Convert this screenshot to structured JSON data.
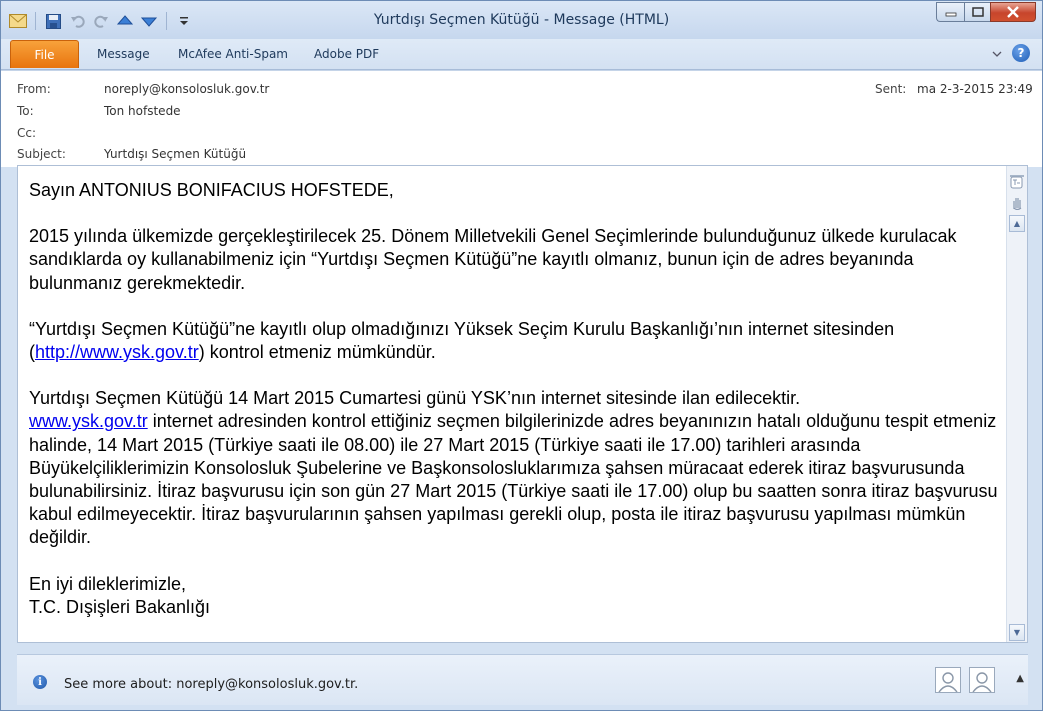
{
  "window": {
    "title": "Yurtdışı Seçmen Kütüğü  -  Message (HTML)"
  },
  "ribbon": {
    "tabs": [
      "File",
      "Message",
      "McAfee Anti-Spam",
      "Adobe PDF"
    ]
  },
  "header": {
    "from_label": "From:",
    "from_value": "noreply@konsolosluk.gov.tr",
    "to_label": "To:",
    "to_value": "Ton hofstede",
    "cc_label": "Cc:",
    "cc_value": "",
    "subject_label": "Subject:",
    "subject_value": "Yurtdışı Seçmen Kütüğü",
    "sent_label": "Sent:",
    "sent_value": "ma 2-3-2015 23:49"
  },
  "body": {
    "greeting": "Sayın ANTONIUS BONIFACIUS HOFSTEDE,",
    "p1": "2015 yılında ülkemizde gerçekleştirilecek 25. Dönem Milletvekili Genel Seçimlerinde bulunduğunuz ülkede kurulacak sandıklarda oy kullanabilmeniz için “Yurtdışı Seçmen Kütüğü”ne kayıtlı olmanız, bunun için de adres beyanında bulunmanız gerekmektedir.",
    "p2_before": "“Yurtdışı Seçmen Kütüğü”ne kayıtlı olup olmadığınızı Yüksek Seçim Kurulu Başkanlığı’nın internet sitesinden (",
    "p2_link": "http://www.ysk.gov.tr",
    "p2_after": ") kontrol etmeniz mümkündür.",
    "p3_line1": "Yurtdışı Seçmen Kütüğü 14 Mart 2015 Cumartesi günü YSK’nın internet sitesinde ilan edilecektir.",
    "p3_link": "www.ysk.gov.tr",
    "p3_rest": " internet adresinden kontrol ettiğiniz seçmen bilgilerinizde adres beyanınızın hatalı olduğunu tespit etmeniz halinde, 14 Mart 2015 (Türkiye saati ile 08.00) ile 27 Mart 2015 (Türkiye saati ile 17.00) tarihleri arasında Büyükelçiliklerimizin Konsolosluk Şubelerine ve Başkonsolosluklarımıza şahsen müracaat ederek itiraz başvurusunda bulunabilirsiniz. İtiraz başvurusu için son gün 27 Mart 2015 (Türkiye saati ile 17.00) olup bu saatten sonra itiraz başvurusu kabul edilmeyecektir. İtiraz başvurularının şahsen yapılması gerekli olup, posta ile itiraz başvurusu yapılması mümkün değildir.",
    "closing": "En iyi dileklerimizle,",
    "signature": "T.C. Dışişleri Bakanlığı"
  },
  "people_pane": {
    "see_more": "See more about: noreply@konsolosluk.gov.tr."
  },
  "icons": {
    "app": "envelope-icon",
    "save": "save-icon",
    "undo": "undo-icon",
    "redo": "redo-icon",
    "prev": "up-arrow-icon",
    "next": "down-arrow-icon",
    "info": "info-icon",
    "help": "help-icon"
  },
  "colors": {
    "file_tab": "#e8740e",
    "link": "#0000ee",
    "close_button": "#c7452c",
    "chrome": "#d3e1f2"
  }
}
